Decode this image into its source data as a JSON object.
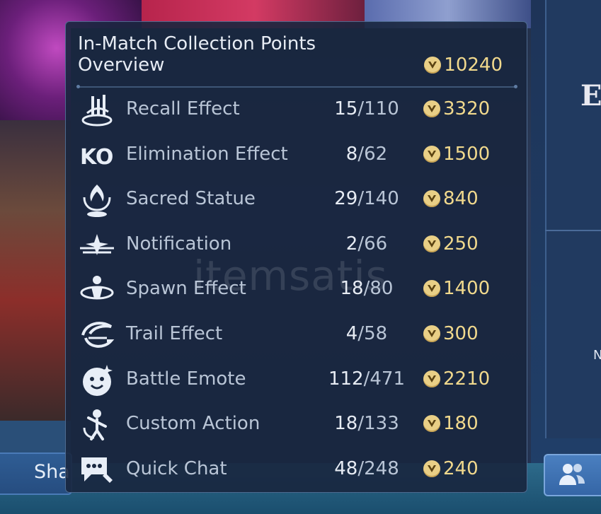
{
  "background": {
    "share_button_label": "Sha",
    "right_panel_letter": "E",
    "right_small_text": "N"
  },
  "overlay": {
    "title": "In-Match Collection Points Overview",
    "total_points": "10240",
    "watermark": "itemsatis",
    "rows": [
      {
        "icon": "recall-effect-icon",
        "label": "Recall Effect",
        "owned": "15",
        "total": "110",
        "points": "3320"
      },
      {
        "icon": "elimination-effect-icon",
        "label": "Elimination Effect",
        "owned": "8",
        "total": "62",
        "points": "1500"
      },
      {
        "icon": "sacred-statue-icon",
        "label": "Sacred Statue",
        "owned": "29",
        "total": "140",
        "points": "840"
      },
      {
        "icon": "notification-icon",
        "label": "Notification",
        "owned": "2",
        "total": "66",
        "points": "250"
      },
      {
        "icon": "spawn-effect-icon",
        "label": "Spawn Effect",
        "owned": "18",
        "total": "80",
        "points": "1400"
      },
      {
        "icon": "trail-effect-icon",
        "label": "Trail Effect",
        "owned": "4",
        "total": "58",
        "points": "300"
      },
      {
        "icon": "battle-emote-icon",
        "label": "Battle Emote",
        "owned": "112",
        "total": "471",
        "points": "2210"
      },
      {
        "icon": "custom-action-icon",
        "label": "Custom Action",
        "owned": "18",
        "total": "133",
        "points": "180"
      },
      {
        "icon": "quick-chat-icon",
        "label": "Quick Chat",
        "owned": "48",
        "total": "248",
        "points": "240"
      }
    ]
  },
  "colors": {
    "accent_gold": "#f1d98d",
    "panel_bg": "#18263e",
    "label": "#b9c5d6"
  }
}
